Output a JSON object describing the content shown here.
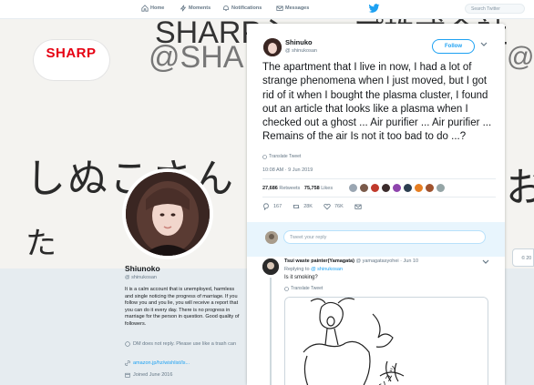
{
  "nav": {
    "home": "Home",
    "moments": "Moments",
    "notifications": "Notifications",
    "messages": "Messages",
    "search_placeholder": "Search Twitter"
  },
  "banner": {
    "logo": "SHARP",
    "top_text": "SHARPシャープ株式会社",
    "handle": "@SHA",
    "right_handle": "@",
    "big_text": "しぬこさん",
    "big_right": "お",
    "bottom_text": "た"
  },
  "profile": {
    "name": "Shiunoko",
    "handle": "@ shinukosan",
    "bio": "It is a calm account that is unemployed, harmless and single noticing the progress of marriage. If you follow you and you lie, you will receive a report that you can do it every day. There is no progress in marriage for the person in question. Good quality of followers.",
    "dm_note": "DM does not reply. Please use like a trash can",
    "link": "amazon.jp/hz/wishlist/ls...",
    "joined": "Joined June 2016",
    "right_tab_text": "© 20"
  },
  "tweet": {
    "name": "Shinuko",
    "handle": "@ shinukosan",
    "follow_label": "Follow",
    "text": "The apartment that I live in now, I had a lot of strange phenomena when I just moved, but I got rid of it when I bought the plasma cluster, I found out an article that looks like a plasma when I checked out a ghost ... Air purifier ... Air purifier ... Remains of the air Is not it too bad to do ...?",
    "translate": "Translate Tweet",
    "timestamp": "10:08 AM · 9 Jun 2019",
    "retweets_count": "27,686",
    "retweets_label": "Retweets",
    "likes_count": "75,758",
    "likes_label": "Likes",
    "reply_count": "167",
    "retweet_action": "28K",
    "like_action": "76K",
    "liker_colors": [
      "#9aa6b2",
      "#7a5a4a",
      "#c0392b",
      "#3b2b2b",
      "#8e44ad",
      "#2c3e50",
      "#e67e22",
      "#a0522d",
      "#95a5a6"
    ]
  },
  "reply_box": {
    "placeholder": "Tweet your reply"
  },
  "reply": {
    "author": "Tsui waste painter(Yamagata)",
    "handle_time": "@ yamagatasyohei · Jun 10",
    "replying_prefix": "Replying to",
    "replying_handle": "@ shinukosan",
    "text": "Is it smoking?",
    "translate": "Translate Tweet",
    "image_caption": "シュッ"
  },
  "colors": {
    "accent": "#1da1f2",
    "sharp_red": "#e60012"
  }
}
